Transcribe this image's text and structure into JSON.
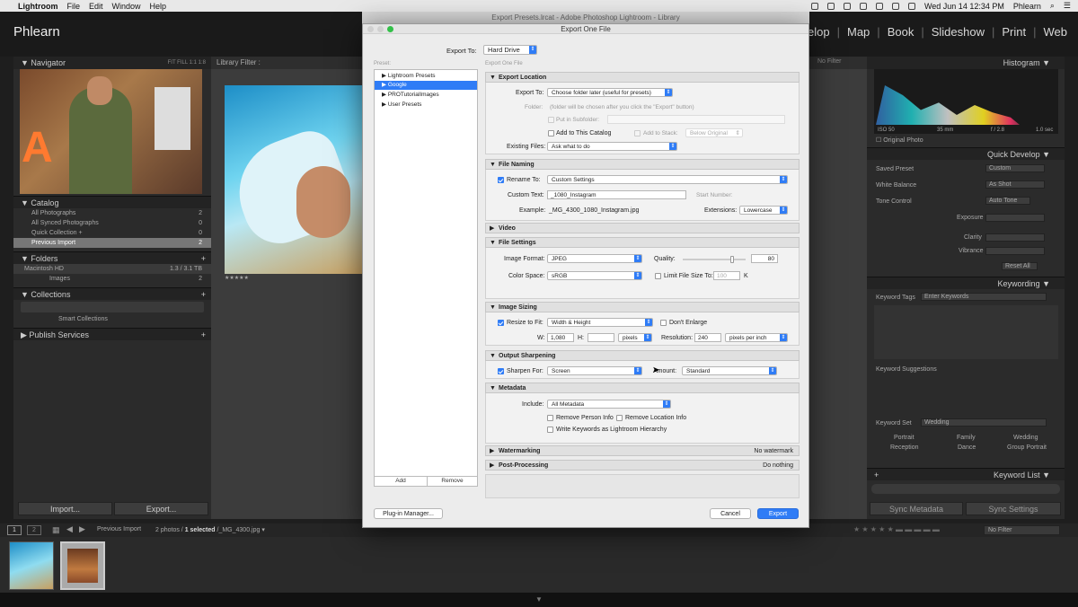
{
  "mac_menu": {
    "app": "Lightroom",
    "items": [
      "File",
      "Edit",
      "Window",
      "Help"
    ],
    "clock": "Wed Jun 14  12:34 PM",
    "user": "Phlearn",
    "window_title": "Export Presets.lrcat - Adobe Photoshop Lightroom - Library"
  },
  "lr": {
    "identity": "Phlearn",
    "modules": [
      "Develop",
      "Map",
      "Book",
      "Slideshow",
      "Print",
      "Web"
    ],
    "library_filter": "Library Filter :",
    "no_filter": "No Filter"
  },
  "left_panel": {
    "navigator": "Navigator",
    "nav_zoom": [
      "FIT",
      "FILL",
      "1:1",
      "1:8"
    ],
    "catalog": "Catalog",
    "catalog_items": [
      {
        "label": "All Photographs",
        "count": "2"
      },
      {
        "label": "All Synced Photographs",
        "count": "0"
      },
      {
        "label": "Quick Collection +",
        "count": "0"
      },
      {
        "label": "Previous Import",
        "count": "2"
      }
    ],
    "folders": "Folders",
    "drive": "Macintosh HD",
    "drive_size": "1.3 / 3.1 TB",
    "folder_images": "Images",
    "folder_images_count": "2",
    "collections": "Collections",
    "smart_collections": "Smart Collections",
    "publish": "Publish Services",
    "import_btn": "Import...",
    "export_btn": "Export..."
  },
  "right_panel": {
    "histogram": "Histogram",
    "hist_info": [
      "ISO 50",
      "35 mm",
      "f / 2.8",
      "1.0 sec"
    ],
    "original_photo": "Original Photo",
    "quick_develop": "Quick Develop",
    "saved_preset": "Saved Preset",
    "saved_preset_val": "Custom",
    "white_balance": "White Balance",
    "white_balance_val": "As Shot",
    "tone_control": "Tone Control",
    "auto_tone": "Auto Tone",
    "sliders": [
      "Exposure",
      "Clarity",
      "Vibrance"
    ],
    "reset_all": "Reset All",
    "keywording": "Keywording",
    "keyword_tags": "Keyword Tags",
    "keyword_tags_val": "Enter Keywords",
    "keyword_suggestions": "Keyword Suggestions",
    "keyword_set": "Keyword Set",
    "keyword_set_val": "Wedding",
    "kw_grid": [
      "Portrait",
      "Family",
      "Wedding",
      "Reception",
      "Dance",
      "Group Portrait"
    ],
    "keyword_list": "Keyword List",
    "sync_metadata": "Sync Metadata",
    "sync_settings": "Sync Settings"
  },
  "filmstrip": {
    "source": "Previous Import",
    "selection_prefix": "2 photos / ",
    "selection_count": "1 selected",
    "selection_file": " /_MG_4300.jpg",
    "filter": "No Filter"
  },
  "dialog": {
    "title": "Export One File",
    "export_to_label": "Export To:",
    "export_to_val": "Hard Drive",
    "preset_label": "Preset:",
    "subtitle": "Export One File",
    "presets": [
      {
        "label": "Lightroom Presets",
        "selected": false
      },
      {
        "label": "Google",
        "selected": true
      },
      {
        "label": "PROTutorialImages",
        "selected": false
      },
      {
        "label": "User Presets",
        "selected": false
      }
    ],
    "add": "Add",
    "remove": "Remove",
    "plugin_manager": "Plug-in Manager...",
    "cancel": "Cancel",
    "export": "Export",
    "sections": {
      "export_location": {
        "title": "Export Location",
        "export_to_label": "Export To:",
        "export_to_val": "Choose folder later (useful for presets)",
        "folder_label": "Folder:",
        "folder_note": "(folder will be chosen after you click the \"Export\" button)",
        "put_in_subfolder": "Put in Subfolder:",
        "add_to_catalog": "Add to This Catalog",
        "add_to_stack": "Add to Stack:",
        "stack_val": "Below Original",
        "existing_files_label": "Existing Files:",
        "existing_files_val": "Ask what to do"
      },
      "file_naming": {
        "title": "File Naming",
        "rename_to": "Rename To:",
        "rename_val": "Custom Settings",
        "custom_text_label": "Custom Text:",
        "custom_text_val": "_1080_Instagram",
        "start_number": "Start Number:",
        "example_label": "Example:",
        "example_val": "_MG_4300_1080_Instagram.jpg",
        "extensions_label": "Extensions:",
        "extensions_val": "Lowercase"
      },
      "video": {
        "title": "Video"
      },
      "file_settings": {
        "title": "File Settings",
        "format_label": "Image Format:",
        "format_val": "JPEG",
        "quality_label": "Quality:",
        "quality_val": "80",
        "quality_level": 0.8,
        "color_space_label": "Color Space:",
        "color_space_val": "sRGB",
        "limit_label": "Limit File Size To:",
        "limit_val": "100",
        "limit_unit": "K"
      },
      "image_sizing": {
        "title": "Image Sizing",
        "resize_label": "Resize to Fit:",
        "resize_val": "Width & Height",
        "dont_enlarge": "Don't Enlarge",
        "w_label": "W:",
        "w_val": "1,080",
        "h_label": "H:",
        "h_val": "",
        "unit_val": "pixels",
        "resolution_label": "Resolution:",
        "resolution_val": "240",
        "res_unit_val": "pixels per inch"
      },
      "output_sharpening": {
        "title": "Output Sharpening",
        "sharpen_label": "Sharpen For:",
        "sharpen_val": "Screen",
        "amount_label": "Amount:",
        "amount_val": "Standard"
      },
      "metadata": {
        "title": "Metadata",
        "include_label": "Include:",
        "include_val": "All Metadata",
        "remove_person": "Remove Person Info",
        "remove_location": "Remove Location Info",
        "write_keywords": "Write Keywords as Lightroom Hierarchy"
      },
      "watermarking": {
        "title": "Watermarking",
        "value": "No watermark"
      },
      "post_processing": {
        "title": "Post-Processing",
        "value": "Do nothing"
      }
    }
  }
}
